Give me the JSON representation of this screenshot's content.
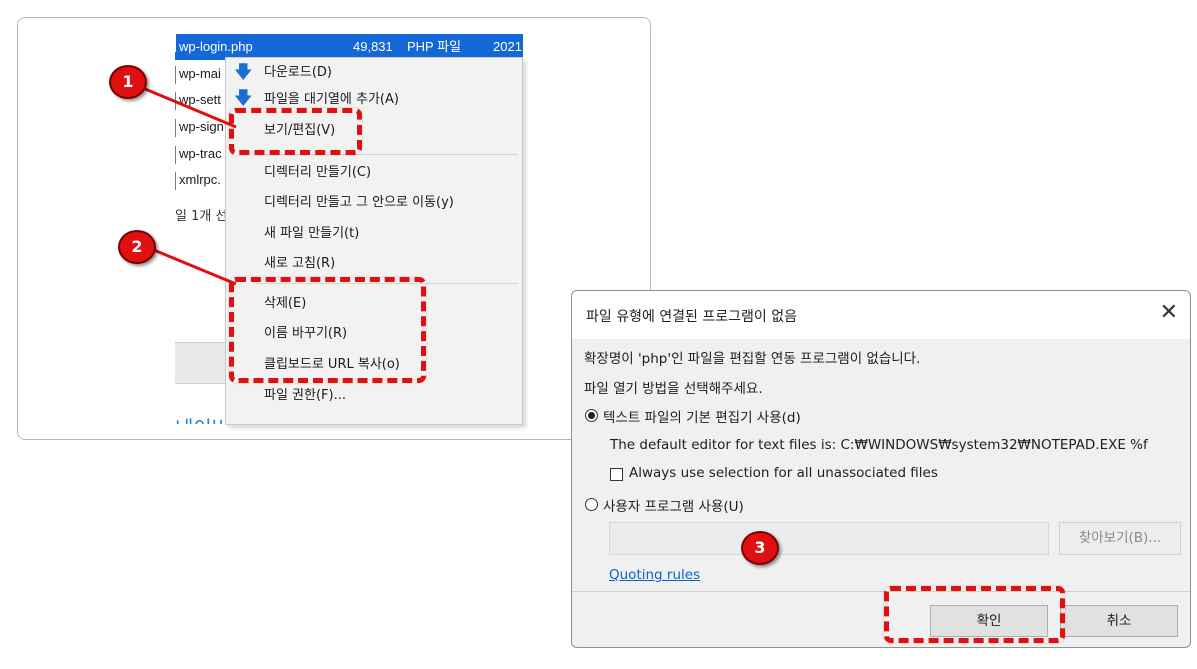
{
  "files": [
    {
      "name": "wp-login.php",
      "size": "49,831",
      "type": "PHP 파일",
      "date": "2021",
      "selected": true
    },
    {
      "name": "wp-mai",
      "selected": false
    },
    {
      "name": "wp-sett",
      "selected": false
    },
    {
      "name": "wp-sign",
      "selected": false
    },
    {
      "name": "wp-trac",
      "selected": false
    },
    {
      "name": "xmlrpc.",
      "selected": false
    }
  ],
  "status_text": "일 1개 선",
  "bottom_text": "네이버 카페 만드기 !",
  "context_menu": {
    "items": [
      {
        "label": "다운로드(D)",
        "icon": "download-icon"
      },
      {
        "label": "파일을 대기열에 추가(A)",
        "icon": "queue-add-icon"
      },
      {
        "label": "보기/편집(V)",
        "icon": ""
      },
      {
        "label": "디렉터리 만들기(C)",
        "icon": ""
      },
      {
        "label": "디렉터리 만들고 그 안으로 이동(y)",
        "icon": ""
      },
      {
        "label": "새 파일 만들기(t)",
        "icon": ""
      },
      {
        "label": "새로 고침(R)",
        "icon": ""
      },
      {
        "label": "삭제(E)",
        "icon": ""
      },
      {
        "label": "이름 바꾸기(R)",
        "icon": ""
      },
      {
        "label": "클립보드로 URL 복사(o)",
        "icon": ""
      },
      {
        "label": "파일 권한(F)...",
        "icon": ""
      }
    ]
  },
  "badges": {
    "one": "1",
    "two": "2",
    "three": "3"
  },
  "dialog": {
    "title": "파일 유형에 연결된 프로그램이 없음",
    "close": "✕",
    "message1": "확장명이 'php'인 파일을 편집할 연동 프로그램이 없습니다.",
    "message2": "파일 열기 방법을 선택해주세요.",
    "option_default": "텍스트 파일의 기본 편집기 사용(d)",
    "default_editor_text": "The default editor for text files is: C:₩WINDOWS₩system32₩NOTEPAD.EXE %f",
    "checkbox_label": "Always use selection for all unassociated files",
    "option_custom": "사용자 프로그램 사용(U)",
    "browse_button": "찾아보기(B)...",
    "quoting_rules": "Quoting rules",
    "ok_button": "확인",
    "cancel_button": "취소"
  },
  "colors": {
    "annotation_red": "#e01010",
    "selection_blue": "#1467d6",
    "link_blue": "#0a64c8"
  }
}
